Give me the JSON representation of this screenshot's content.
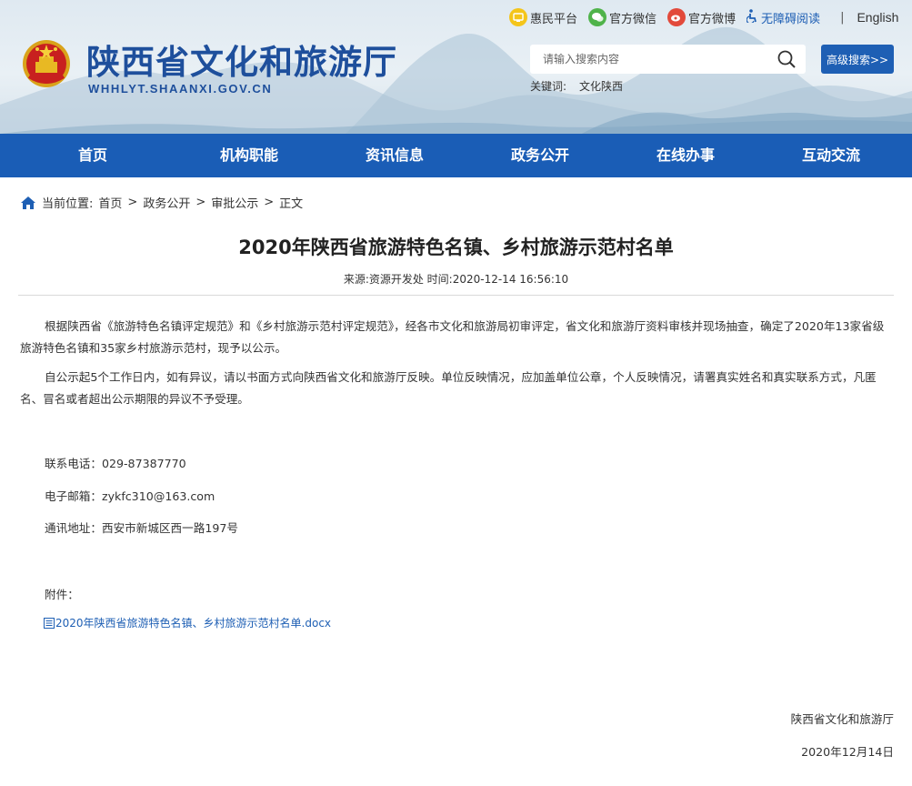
{
  "header": {
    "site_title": "陕西省文化和旅游厅",
    "site_domain": "WHHLYT.SHAANXI.GOV.CN",
    "top_links": {
      "huimin": "惠民平台",
      "wechat": "官方微信",
      "weibo": "官方微博",
      "accessibility": "无障碍阅读",
      "separator": "|",
      "english": "English"
    },
    "search": {
      "placeholder": "请输入搜索内容",
      "button": "高级搜索>>"
    },
    "keywords": {
      "label": "关键词:",
      "items": [
        "文化陕西"
      ]
    }
  },
  "nav": {
    "items": [
      "首页",
      "机构职能",
      "资讯信息",
      "政务公开",
      "在线办事",
      "互动交流"
    ]
  },
  "breadcrumb": {
    "label": "当前位置:",
    "items": [
      "首页",
      "政务公开",
      "审批公示",
      "正文"
    ],
    "sep": ">"
  },
  "article": {
    "title": "2020年陕西省旅游特色名镇、乡村旅游示范村名单",
    "meta": "来源:资源开发处 时间:2020-12-14 16:56:10",
    "paragraphs": [
      "根据陕西省《旅游特色名镇评定规范》和《乡村旅游示范村评定规范》，经各市文化和旅游局初审评定，省文化和旅游厅资料审核并现场抽查，确定了2020年13家省级旅游特色名镇和35家乡村旅游示范村，现予以公示。",
      "自公示起5个工作日内，如有异议，请以书面方式向陕西省文化和旅游厅反映。单位反映情况，应加盖单位公章，个人反映情况，请署真实姓名和真实联系方式，凡匿名、冒名或者超出公示期限的异议不予受理。"
    ],
    "contact": {
      "phone": "联系电话：029-87387770",
      "email": "电子邮箱：zykfc310@163.com",
      "address": "通讯地址：西安市新城区西一路197号"
    },
    "attachment_label": "附件：",
    "attachment_file": "2020年陕西省旅游特色名镇、乡村旅游示范村名单.docx",
    "signature": "陕西省文化和旅游厅",
    "date": "2020年12月14日"
  },
  "colors": {
    "brand_blue": "#1a5db6",
    "link_blue": "#1e5fb4",
    "title_blue": "#1e4f9c"
  }
}
